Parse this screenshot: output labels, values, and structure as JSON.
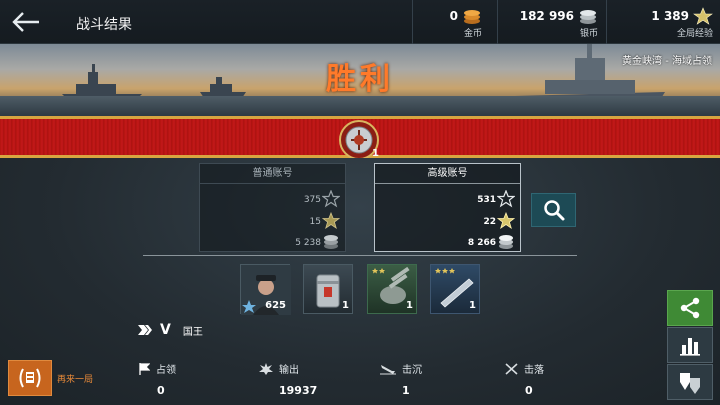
{
  "header": {
    "title": "战斗结果",
    "gold": {
      "value": "0",
      "label": "金币"
    },
    "silver": {
      "value": "182 996",
      "label": "银币"
    },
    "free_xp": {
      "value": "1 389",
      "label": "全局经验"
    }
  },
  "banner": {
    "result": "胜利",
    "map": "黄金峡湾 - 海域占领"
  },
  "medal": {
    "count": "1"
  },
  "accounts": {
    "regular": {
      "title": "普通账号",
      "xp": "375",
      "free_xp": "15",
      "silver": "5 238"
    },
    "premium": {
      "title": "高级账号",
      "xp": "531",
      "free_xp": "22",
      "silver": "8 266"
    }
  },
  "rewards": [
    {
      "name": "crew-xp",
      "count": "625"
    },
    {
      "name": "consumable",
      "count": "1"
    },
    {
      "name": "ship-module",
      "count": "1"
    },
    {
      "name": "ship-blueprint",
      "count": "1"
    }
  ],
  "ship": {
    "tier": "V",
    "name": "国王"
  },
  "retry": {
    "label": "再来一局"
  },
  "stats": [
    {
      "label": "占领",
      "value": "0"
    },
    {
      "label": "输出",
      "value": "19937"
    },
    {
      "label": "击沉",
      "value": "1"
    },
    {
      "label": "击落",
      "value": "0"
    }
  ],
  "colors": {
    "accent_orange": "#ff7a2a",
    "share_green": "#3f8a35",
    "ribbon_red": "#b3140f"
  }
}
